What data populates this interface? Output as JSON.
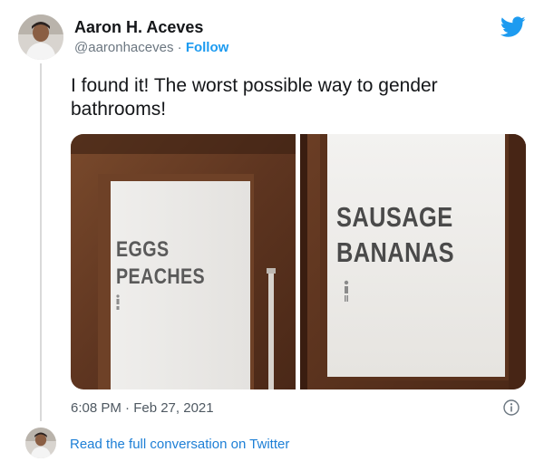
{
  "author": {
    "name": "Aaron H. Aceves",
    "handle": "@aaronhaceves",
    "separator": " · ",
    "follow_label": "Follow"
  },
  "tweet": {
    "text": "I found it! The worst possible way to gender bathrooms!",
    "timestamp": "6:08 PM · Feb 27, 2021",
    "read_more": "Read the full conversation on Twitter"
  },
  "media": {
    "left_sign": [
      "EGGS",
      "PEACHES"
    ],
    "right_sign": [
      "SAUSAGE",
      "BANANAS"
    ]
  },
  "icons": {
    "brand": "twitter-bird-icon",
    "info": "info-icon"
  },
  "colors": {
    "accent": "#1d9bf0",
    "link": "#1d7fd6",
    "text": "#141619",
    "muted": "#6b7680"
  }
}
